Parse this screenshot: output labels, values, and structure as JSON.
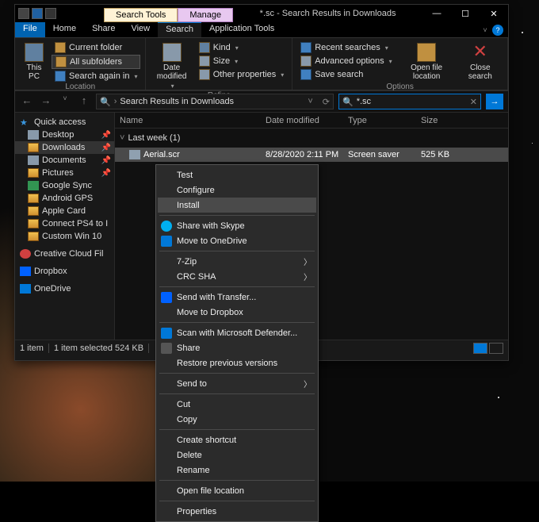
{
  "titlebar": {
    "context_search": "Search Tools",
    "context_manage": "Manage",
    "title": "*.sc - Search Results in Downloads",
    "min": "—",
    "max": "☐",
    "close": "✕"
  },
  "tabs": {
    "file": "File",
    "home": "Home",
    "share": "Share",
    "view": "View",
    "search": "Search",
    "apptools": "Application Tools"
  },
  "ribbon": {
    "thispc": "This PC",
    "location_items": [
      "Current folder",
      "All subfolders",
      "Search again in"
    ],
    "location": "Location",
    "date_modified": "Date modified",
    "refine_items": [
      "Kind",
      "Size",
      "Other properties"
    ],
    "refine": "Refine",
    "options_items": [
      "Recent searches",
      "Advanced options",
      "Save search"
    ],
    "open_file": "Open file location",
    "close_search": "Close search",
    "options": "Options"
  },
  "addr": {
    "path": "Search Results in Downloads",
    "search_value": "*.sc",
    "clear": "✕",
    "go": "→",
    "refresh": "⟳"
  },
  "columns": {
    "name": "Name",
    "date": "Date modified",
    "type": "Type",
    "size": "Size"
  },
  "group": {
    "label": "Last week (1)"
  },
  "file": {
    "name": "Aerial.scr",
    "date": "8/28/2020 2:11 PM",
    "type": "Screen saver",
    "size": "525 KB"
  },
  "sidebar": {
    "quick": "Quick access",
    "items": [
      {
        "label": "Desktop",
        "pin": true,
        "fold": false
      },
      {
        "label": "Downloads",
        "pin": true,
        "fold": true,
        "sel": true
      },
      {
        "label": "Documents",
        "pin": true,
        "fold": false
      },
      {
        "label": "Pictures",
        "pin": true,
        "fold": true
      },
      {
        "label": "Google Sync",
        "pin": false,
        "fold": true
      },
      {
        "label": "Android GPS",
        "pin": false,
        "fold": true
      },
      {
        "label": "Apple Card",
        "pin": false,
        "fold": true
      },
      {
        "label": "Connect PS4 to I",
        "pin": false,
        "fold": true
      },
      {
        "label": "Custom Win 10",
        "pin": false,
        "fold": true
      }
    ],
    "ccloud": "Creative Cloud Fil",
    "dropbox": "Dropbox",
    "onedrive": "OneDrive"
  },
  "status": {
    "count": "1 item",
    "selected": "1 item selected  524 KB"
  },
  "ctx": {
    "test": "Test",
    "configure": "Configure",
    "install": "Install",
    "skype": "Share with Skype",
    "onedrive": "Move to OneDrive",
    "7zip": "7-Zip",
    "crc": "CRC SHA",
    "transfer": "Send with Transfer...",
    "dropbox": "Move to Dropbox",
    "defender": "Scan with Microsoft Defender...",
    "share": "Share",
    "restore": "Restore previous versions",
    "sendto": "Send to",
    "cut": "Cut",
    "copy": "Copy",
    "shortcut": "Create shortcut",
    "delete": "Delete",
    "rename": "Rename",
    "openloc": "Open file location",
    "props": "Properties"
  }
}
